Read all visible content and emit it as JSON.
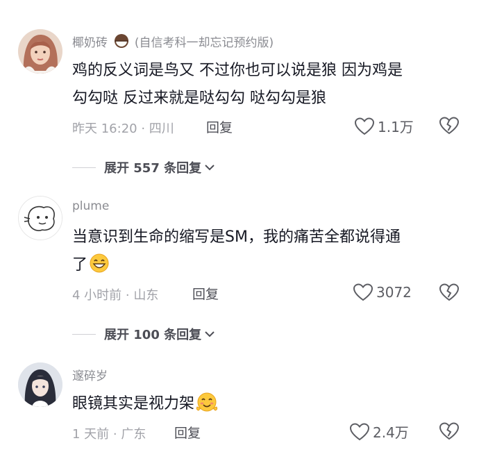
{
  "comments": [
    {
      "username": "椰奶砖",
      "badge": "(自信考科一却忘记预约版)",
      "lines": [
        "鸡的反义词是鸟又 不过你也可以说是狼 因为鸡是",
        "勾勾哒 反过来就是哒勾勾 哒勾勾是狼"
      ],
      "time_location": "昨天 16:20 · 四川",
      "reply_label": "回复",
      "likes": "1.1万",
      "expand_label": "展开 557 条回复"
    },
    {
      "username": "plume",
      "lines": [
        "当意识到生命的缩写是SM，我的痛苦全都说得通",
        "了"
      ],
      "time_location": "4 小时前 · 山东",
      "reply_label": "回复",
      "likes": "3072",
      "expand_label": "展开 100 条回复"
    },
    {
      "username": "邃碎岁",
      "lines": [
        "眼镜其实是视力架"
      ],
      "time_location": "1 天前 · 广东",
      "reply_label": "回复",
      "likes": "2.4万"
    }
  ],
  "icons": {
    "like": "heart-outline-icon",
    "dislike": "broken-heart-icon",
    "expand": "chevron-down-icon"
  },
  "colors": {
    "text": "#161823",
    "secondary": "#8a8b91",
    "meta": "#a1a2a8"
  }
}
